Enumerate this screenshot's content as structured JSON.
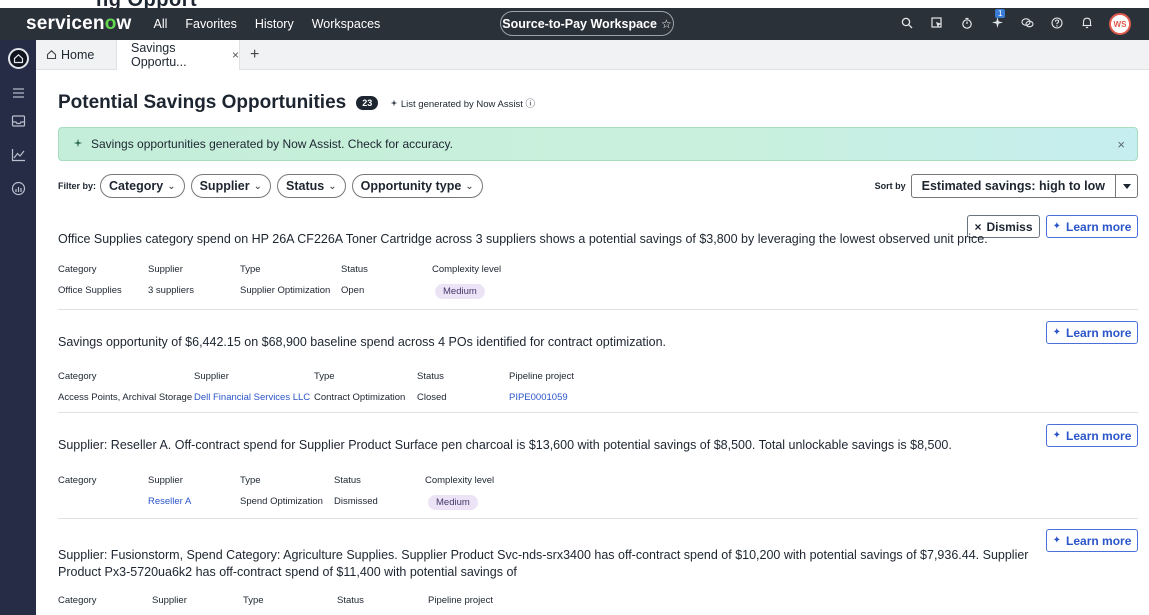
{
  "topstrip": {
    "partial_title": "ng Opport"
  },
  "app": {
    "logo_main": "servicen",
    "logo_o": "o",
    "logo_end": "w",
    "nav": [
      "All",
      "Favorites",
      "History",
      "Workspaces"
    ],
    "workspace_pill": "Source-to-Pay Workspace",
    "pill_star": "☆",
    "avatar_initials": "WS",
    "notification_count": "1"
  },
  "tabs": {
    "home_label": "Home",
    "active_label": "Savings Opportu...",
    "close": "×",
    "add": "+"
  },
  "page": {
    "title": "Potential Savings Opportunities",
    "count": "23",
    "generated_note": "List generated by Now Assist ⓘ"
  },
  "banner": {
    "text": "Savings opportunities generated by Now Assist. Check for accuracy.",
    "close": "×"
  },
  "filters": {
    "label": "Filter by:",
    "chips": [
      "Category",
      "Supplier",
      "Status",
      "Opportunity type"
    ],
    "sort_label": "Sort by",
    "sort_value": "Estimated savings: high to low"
  },
  "buttons": {
    "dismiss": "Dismiss",
    "learn_more": "Learn more"
  },
  "cards": [
    {
      "desc": "Office Supplies category spend on HP 26A CF226A Toner Cartridge across 3 suppliers shows a potential savings of $3,800 by leveraging the lowest observed unit price.",
      "fields": [
        {
          "label": "Category",
          "value": "Office Supplies"
        },
        {
          "label": "Supplier",
          "value": "3 suppliers"
        },
        {
          "label": "Type",
          "value": "Supplier Optimization"
        },
        {
          "label": "Status",
          "value": "Open"
        },
        {
          "label": "Complexity level",
          "value": "Medium"
        }
      ]
    },
    {
      "desc": "Savings opportunity of $6,442.15 on $68,900 baseline spend across 4 POs identified for contract optimization.",
      "fields": [
        {
          "label": "Category",
          "value": "Access Points, Archival Storage"
        },
        {
          "label": "Supplier",
          "value": "Dell Financial Services LLC"
        },
        {
          "label": "Type",
          "value": "Contract Optimization"
        },
        {
          "label": "Status",
          "value": "Closed"
        },
        {
          "label": "Pipeline project",
          "value": "PIPE0001059"
        }
      ]
    },
    {
      "desc": "Supplier: Reseller A. Off-contract spend for Supplier Product Surface pen charcoal is $13,600 with potential savings of $8,500. Total unlockable savings is $8,500.",
      "fields": [
        {
          "label": "Category",
          "value": ""
        },
        {
          "label": "Supplier",
          "value": "Reseller A"
        },
        {
          "label": "Type",
          "value": "Spend Optimization"
        },
        {
          "label": "Status",
          "value": "Dismissed"
        },
        {
          "label": "Complexity level",
          "value": "Medium"
        }
      ]
    },
    {
      "desc": "Supplier: Fusionstorm, Spend Category: Agriculture Supplies. Supplier Product Svc-nds-srx3400 has off-contract spend of $10,200 with potential savings of $7,936.44. Supplier Product Px3-5720ua6k2 has off-contract spend of $11,400 with potential savings of",
      "fields": [
        {
          "label": "Category",
          "value": ""
        },
        {
          "label": "Supplier",
          "value": ""
        },
        {
          "label": "Type",
          "value": ""
        },
        {
          "label": "Status",
          "value": ""
        },
        {
          "label": "Pipeline project",
          "value": ""
        }
      ]
    }
  ],
  "colors": {
    "topbar": "#2b3139",
    "sidebar": "#262c45",
    "link": "#2b55c9",
    "logo_accent": "#62d84e",
    "tag_bg": "#ece4f6"
  }
}
